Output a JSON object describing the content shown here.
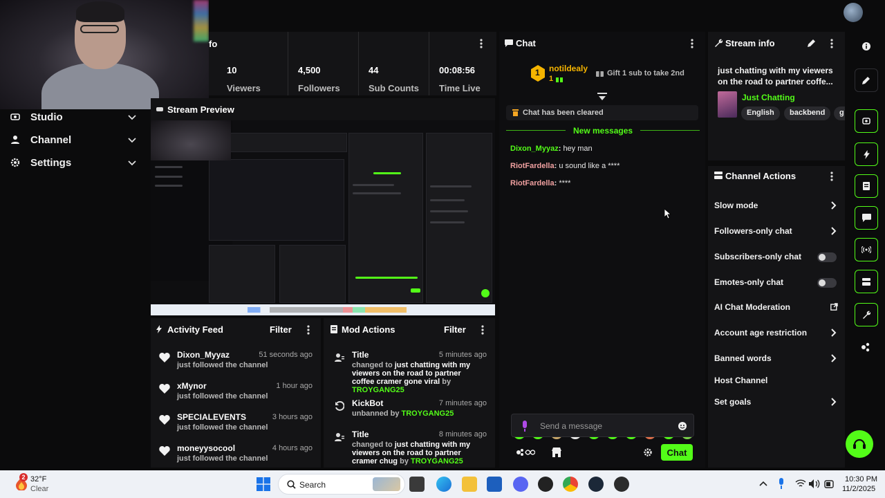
{
  "colors": {
    "accent": "#53fc18",
    "panel": "#141416",
    "background": "#0b0b0c"
  },
  "nav": {
    "items": [
      {
        "label": "Studio",
        "icon": "studio-icon"
      },
      {
        "label": "Channel",
        "icon": "channel-icon"
      },
      {
        "label": "Settings",
        "icon": "gear-icon"
      }
    ]
  },
  "stats": {
    "panel_title_fragment": "fo",
    "items": [
      {
        "value": "10",
        "label": "Viewers"
      },
      {
        "value": "4,500",
        "label": "Followers"
      },
      {
        "value": "44",
        "label": "Sub Counts"
      },
      {
        "value": "00:08:56",
        "label": "Time Live"
      }
    ]
  },
  "preview": {
    "title": "Stream Preview"
  },
  "activity_feed": {
    "title": "Activity Feed",
    "filter_label": "Filter",
    "items": [
      {
        "name": "Dixon_Myyaz",
        "action": "just followed the channel",
        "time": "51 seconds ago"
      },
      {
        "name": "xMynor",
        "action": "just followed the channel",
        "time": "1 hour ago"
      },
      {
        "name": "SPECIALEVENTS",
        "action": "just followed the channel",
        "time": "3 hours ago"
      },
      {
        "name": "moneyysocool",
        "action": "just followed the channel",
        "time": "4 hours ago"
      }
    ]
  },
  "mod_actions": {
    "title": "Mod Actions",
    "filter_label": "Filter",
    "items": [
      {
        "title": "Title",
        "time": "5 minutes ago",
        "prefix": "changed to",
        "highlight": "just chatting with my viewers on the road to partner coffee cramer gone viral",
        "by": "by",
        "user": "TROYGANG25"
      },
      {
        "title": "KickBot",
        "time": "7 minutes ago",
        "prefix": "unbanned by",
        "highlight": "",
        "by": "",
        "user": "TROYGANG25"
      },
      {
        "title": "Title",
        "time": "8 minutes ago",
        "prefix": "changed to",
        "highlight": "just chatting with my viewers on the road to partner cramer chug",
        "by": "by",
        "user": "TROYGANG25"
      }
    ]
  },
  "chat": {
    "title": "Chat",
    "leader": {
      "rank": "1",
      "name": "notildealy",
      "count": "1"
    },
    "gift_prompt": "Gift 1 sub to take 2nd",
    "cleared_notice": "Chat has been cleared",
    "new_messages_label": "New messages",
    "messages": [
      {
        "user": "Dixon_Myyaz",
        "user_color": "#53fc18",
        "text": "hey man"
      },
      {
        "user": "RiotFardella",
        "user_color": "#e8e8e8",
        "text": "u sound like a ****"
      },
      {
        "user": "RiotFardella",
        "user_color": "#e8e8e8",
        "text": "****"
      }
    ],
    "input_placeholder": "Send a message",
    "send_label": "Chat"
  },
  "stream_info": {
    "title": "Stream info",
    "stream_title": "just chatting with my viewers on the road to partner coffe...",
    "category": "Just Chatting",
    "tags": [
      "English",
      "backbend",
      "g"
    ]
  },
  "channel_actions": {
    "title": "Channel Actions",
    "items": [
      {
        "label": "Slow mode",
        "control": "chevron"
      },
      {
        "label": "Followers-only chat",
        "control": "chevron"
      },
      {
        "label": "Subscribers-only chat",
        "control": "toggle"
      },
      {
        "label": "Emotes-only chat",
        "control": "toggle"
      },
      {
        "label": "AI Chat Moderation",
        "control": "external"
      },
      {
        "label": "Account age restriction",
        "control": "chevron"
      },
      {
        "label": "Banned words",
        "control": "chevron"
      },
      {
        "label": "Host Channel",
        "control": "none"
      },
      {
        "label": "Set goals",
        "control": "chevron"
      }
    ]
  },
  "taskbar": {
    "weather_temp": "32°F",
    "weather_desc": "Clear",
    "search_label": "Search",
    "time": "10:30 PM",
    "date": "11/2/2025",
    "notification_count": "2"
  }
}
